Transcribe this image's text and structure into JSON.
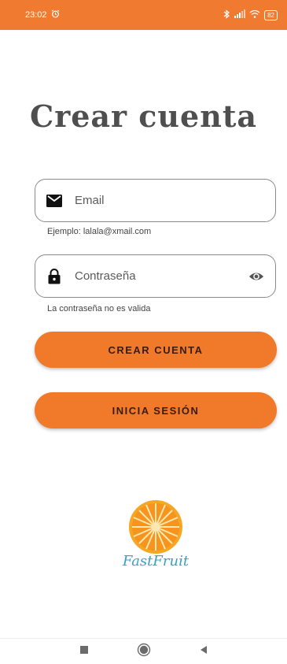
{
  "status_bar": {
    "time": "23:02",
    "battery": "82",
    "background_color": "#f07a30"
  },
  "page": {
    "title": "Crear cuenta"
  },
  "form": {
    "email": {
      "placeholder": "Email",
      "helper": "Ejemplo: lalala@xmail.com",
      "icon": "email-icon"
    },
    "password": {
      "placeholder": "Contraseña",
      "helper": "La contraseña no es valida",
      "icon": "lock-icon",
      "toggle_icon": "eye-icon"
    }
  },
  "buttons": {
    "create_account": "CREAR CUENTA",
    "login": "INICIA SESIÓN",
    "color": "#f07a2a"
  },
  "logo": {
    "text": "FastFruit"
  },
  "nav": {
    "recents_icon": "square-icon",
    "home_icon": "circle-icon",
    "back_icon": "back-triangle-icon"
  }
}
